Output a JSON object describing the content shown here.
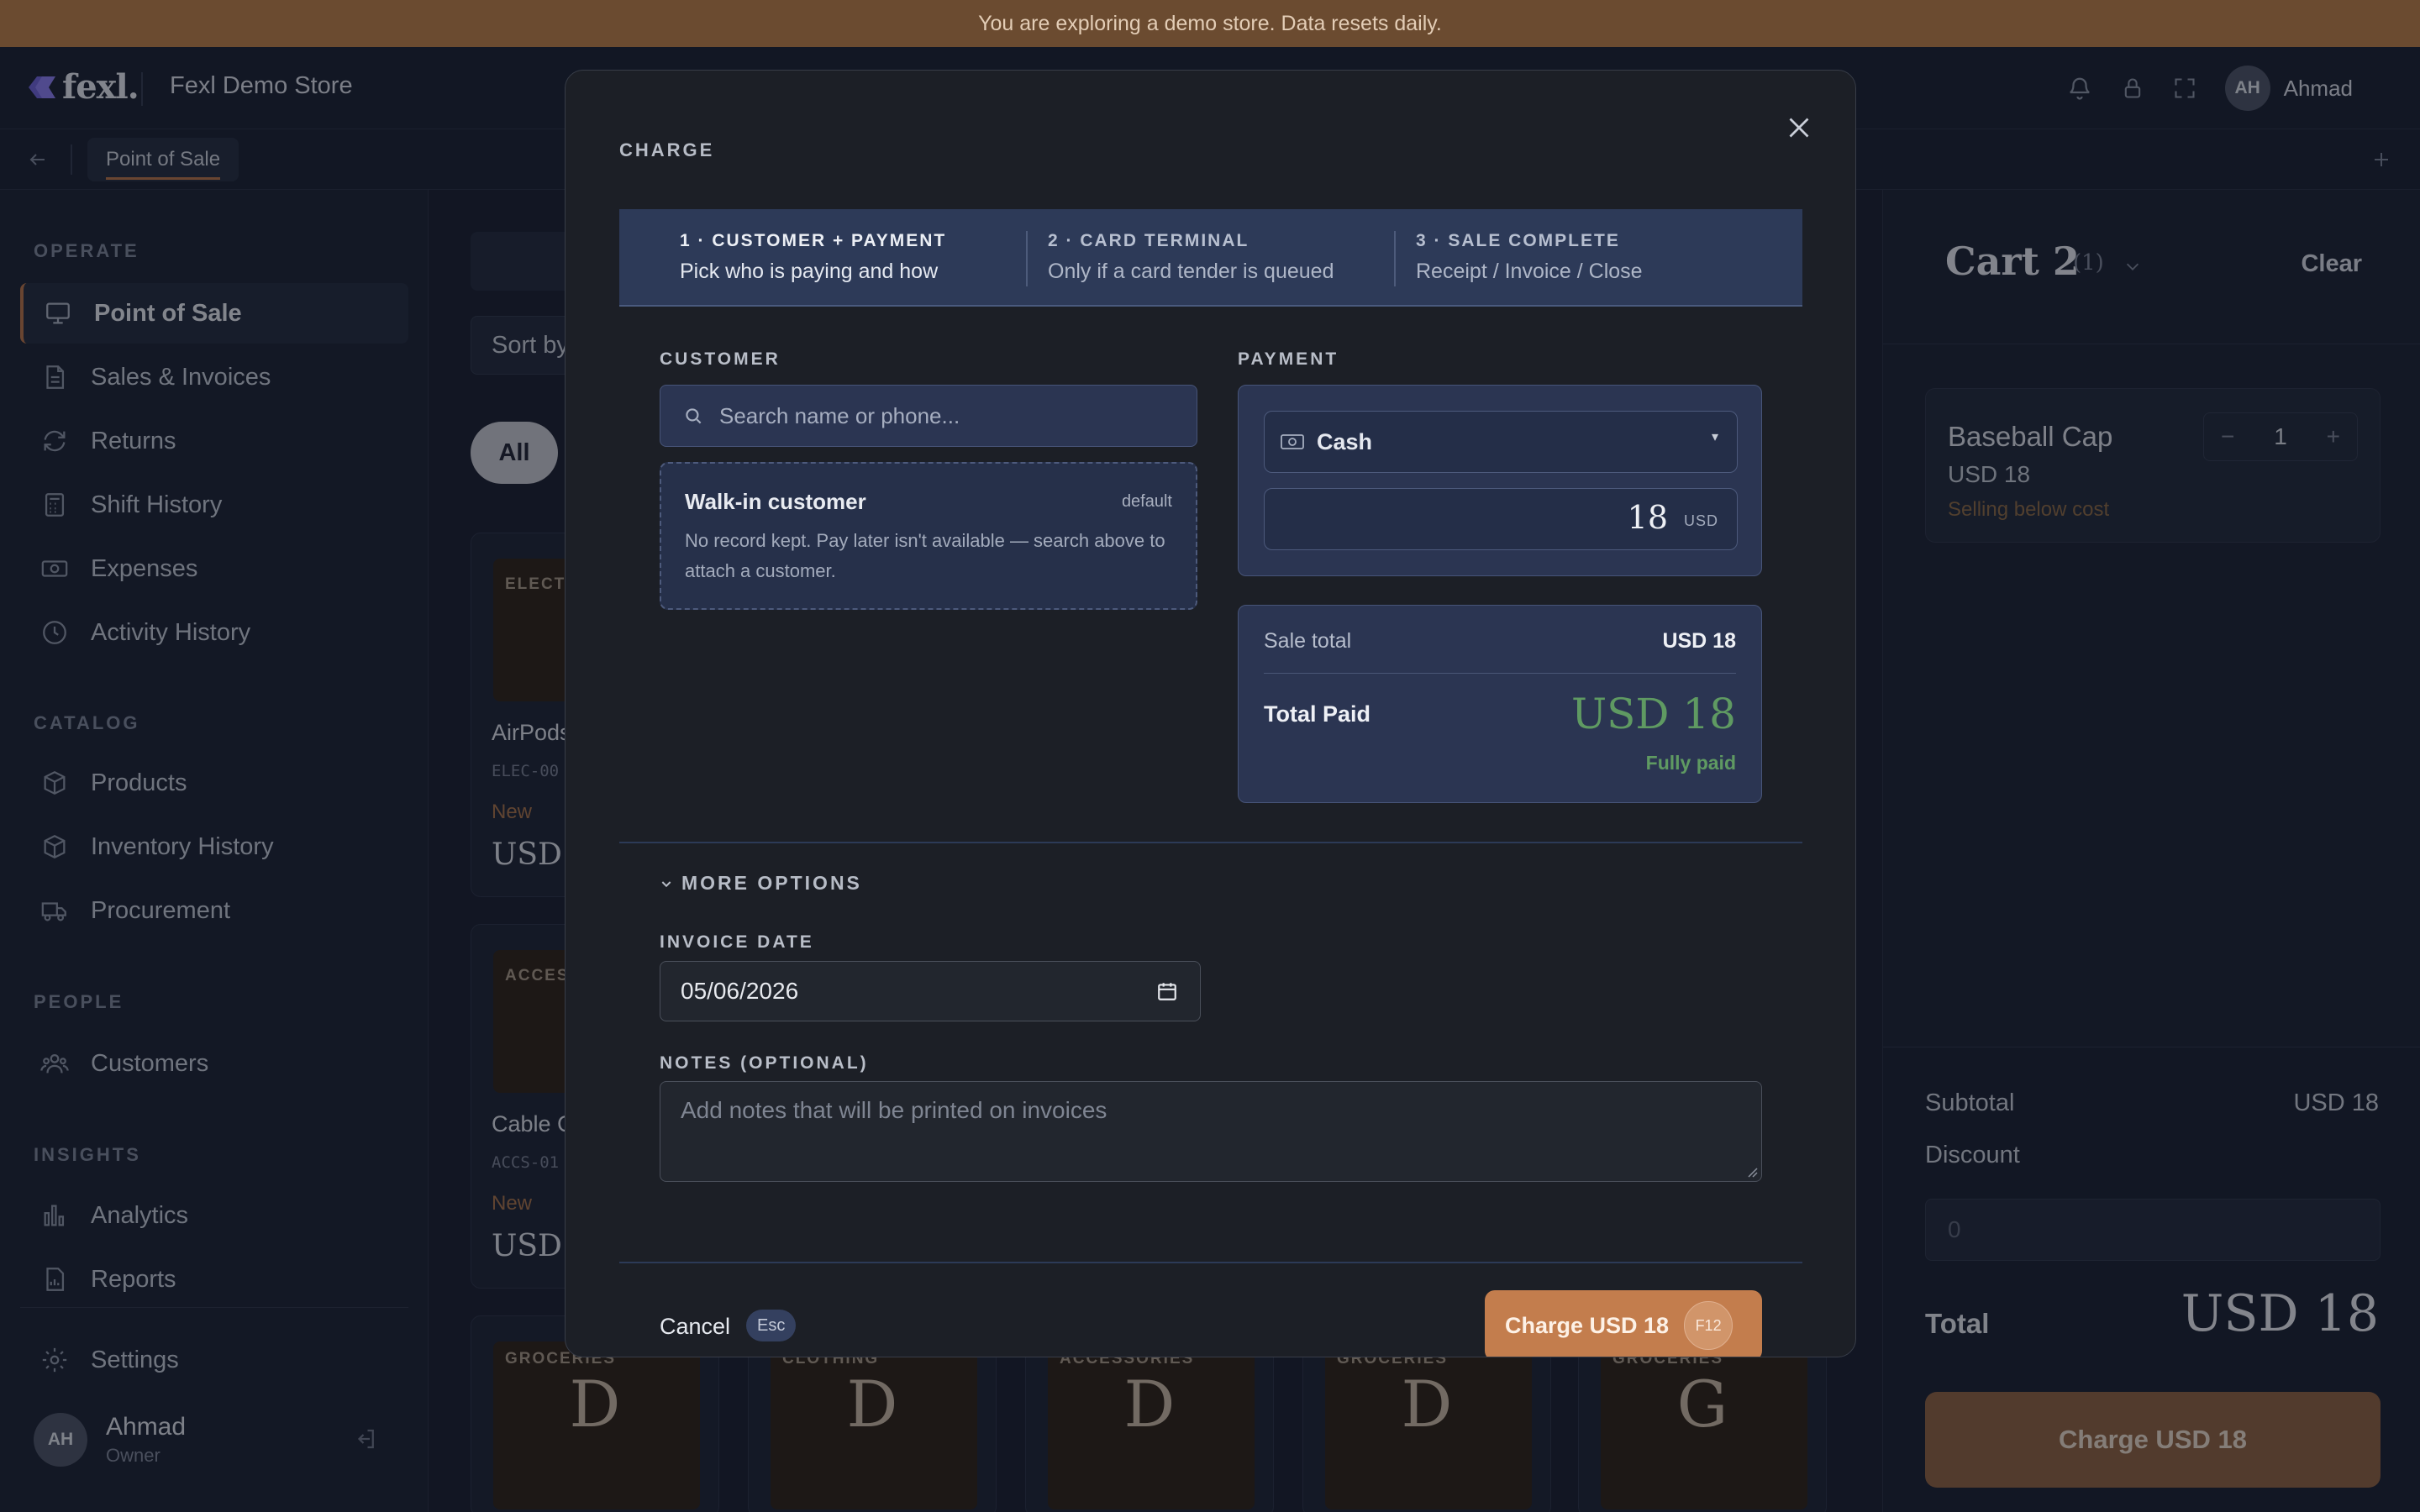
{
  "banner": {
    "text": "You are exploring a demo store. Data resets daily."
  },
  "header": {
    "logo_text": "fexl.",
    "store_name": "Fexl Demo Store",
    "user_initials": "AH",
    "user_name": "Ahmad",
    "icons": [
      "bell-icon",
      "lock-icon",
      "fullscreen-icon"
    ]
  },
  "tabbar": {
    "active_tab": "Point of Sale"
  },
  "sidebar": {
    "sections": [
      {
        "title": "OPERATE",
        "items": [
          {
            "label": "Point of Sale",
            "icon": "monitor-icon",
            "active": true
          },
          {
            "label": "Sales & Invoices",
            "icon": "document-icon"
          },
          {
            "label": "Returns",
            "icon": "refresh-icon"
          },
          {
            "label": "Shift History",
            "icon": "calculator-icon"
          },
          {
            "label": "Expenses",
            "icon": "cash-icon"
          },
          {
            "label": "Activity History",
            "icon": "clock-icon"
          }
        ]
      },
      {
        "title": "CATALOG",
        "items": [
          {
            "label": "Products",
            "icon": "box-icon"
          },
          {
            "label": "Inventory History",
            "icon": "box-icon"
          },
          {
            "label": "Procurement",
            "icon": "truck-icon"
          }
        ]
      },
      {
        "title": "PEOPLE",
        "items": [
          {
            "label": "Customers",
            "icon": "users-icon"
          }
        ]
      },
      {
        "title": "INSIGHTS",
        "items": [
          {
            "label": "Analytics",
            "icon": "bar-chart-icon"
          },
          {
            "label": "Reports",
            "icon": "report-icon"
          }
        ]
      }
    ],
    "settings": "Settings",
    "user": {
      "initials": "AH",
      "name": "Ahmad",
      "role": "Owner"
    }
  },
  "main": {
    "sort_label": "Sort by",
    "filter_all": "All",
    "products": [
      {
        "category": "ELECTR",
        "name": "AirPods",
        "sku": "ELEC-00",
        "badge": "New",
        "price": "USD"
      },
      {
        "category": "ACCES",
        "name": "Cable C",
        "sku": "ACCS-01",
        "badge": "New",
        "price": "USD"
      }
    ],
    "bottom_cards": [
      {
        "category": "GROCERIES",
        "letter": "D"
      },
      {
        "category": "CLOTHING",
        "letter": "D"
      },
      {
        "category": "ACCESSORIES",
        "letter": "D"
      },
      {
        "category": "GROCERIES",
        "letter": "D"
      },
      {
        "category": "GROCERIES",
        "letter": "G"
      }
    ]
  },
  "cart": {
    "title": "Cart 2",
    "count": "(1)",
    "clear": "Clear",
    "item": {
      "name": "Baseball Cap",
      "price": "USD 18",
      "warning": "Selling below cost",
      "qty": "1"
    },
    "subtotal_label": "Subtotal",
    "subtotal": "USD 18",
    "discount_label": "Discount",
    "discount_placeholder": "0",
    "total_label": "Total",
    "total": "USD 18",
    "charge": "Charge USD 18"
  },
  "modal": {
    "title": "CHARGE",
    "steps": [
      {
        "head": "1 · CUSTOMER + PAYMENT",
        "sub": "Pick who is paying and how",
        "active": true
      },
      {
        "head": "2 · CARD TERMINAL",
        "sub": "Only if a card tender is queued"
      },
      {
        "head": "3 · SALE COMPLETE",
        "sub": "Receipt / Invoice / Close"
      }
    ],
    "customer": {
      "label": "CUSTOMER",
      "search_placeholder": "Search name or phone...",
      "walkin_name": "Walk-in customer",
      "walkin_tag": "default",
      "walkin_desc": "No record kept. Pay later isn't available — search above to attach a customer."
    },
    "payment": {
      "label": "PAYMENT",
      "method": "Cash",
      "amount": "18",
      "currency": "USD",
      "sale_total_label": "Sale total",
      "sale_total": "USD 18",
      "total_paid_label": "Total Paid",
      "total_paid": "USD 18",
      "status": "Fully paid"
    },
    "more_options": "MORE OPTIONS",
    "invoice_date_label": "INVOICE DATE",
    "invoice_date": "05/06/2026",
    "notes_label": "NOTES (OPTIONAL)",
    "notes_placeholder": "Add notes that will be printed on invoices",
    "cancel": "Cancel",
    "cancel_key": "Esc",
    "charge": "Charge USD 18",
    "charge_key": "F12"
  },
  "colors": {
    "accent": "#c37d4d",
    "paid_green": "#5f9a62",
    "step_bg": "#2d3a58"
  }
}
